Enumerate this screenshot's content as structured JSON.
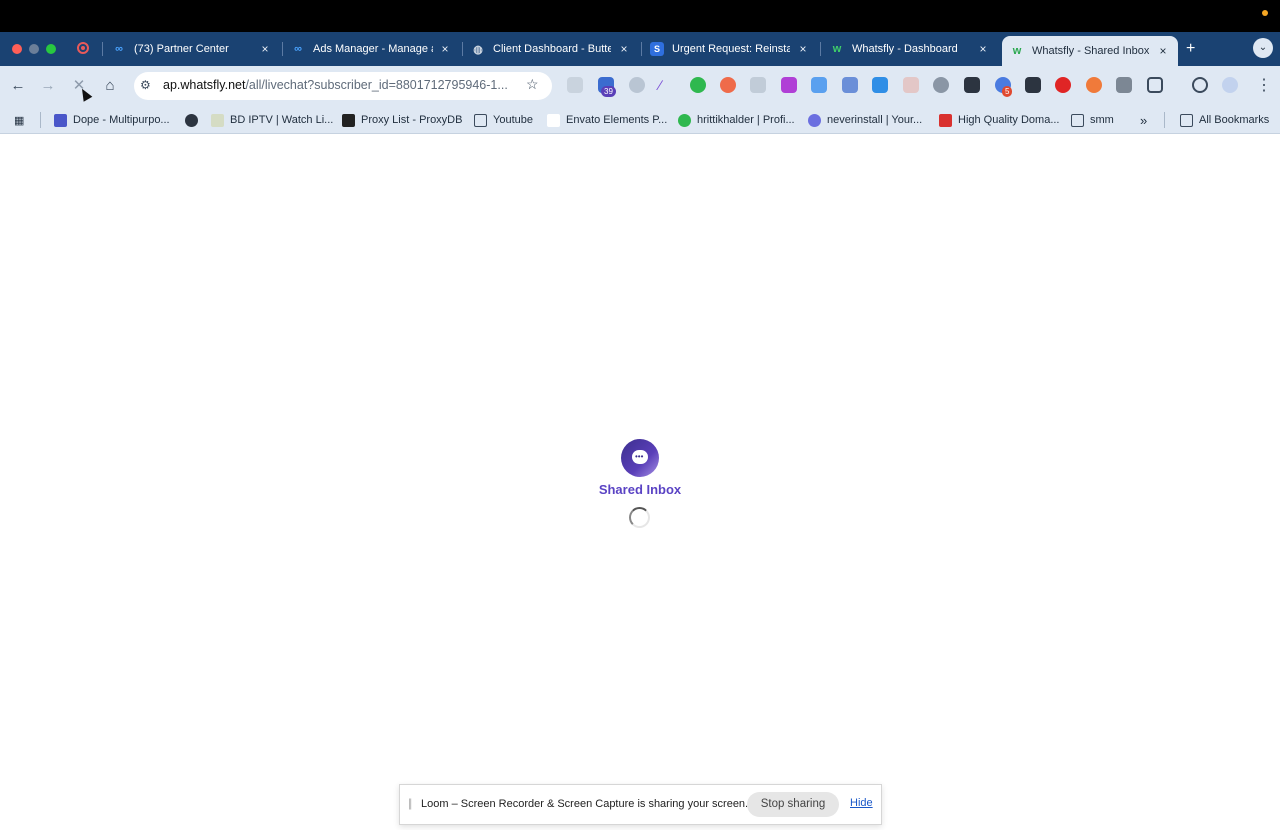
{
  "tabs": [
    {
      "label": "(73) Partner Center",
      "favicon": "meta-icon",
      "close": "×"
    },
    {
      "label": "Ads Manager - Manage a",
      "favicon": "meta-icon",
      "close": "×"
    },
    {
      "label": "Client Dashboard - Butte",
      "favicon": "globe-icon",
      "close": "×"
    },
    {
      "label": "Urgent Request: Reinsta",
      "favicon": "doc-icon",
      "close": "×"
    },
    {
      "label": "Whatsfly - Dashboard",
      "favicon": "whatsfly-icon",
      "close": "×"
    },
    {
      "label": "Whatsfly - Shared Inbox",
      "favicon": "whatsfly-icon",
      "close": "×",
      "active": true
    }
  ],
  "newtab": "+",
  "toolbar": {
    "url_host": "ap.whatsfly.net",
    "url_path": "/all/livechat?subscriber_id=8801712795946-1...",
    "extensions_badges": {
      "calendar": "39",
      "puzzle": "5"
    }
  },
  "bookmarks": [
    {
      "label": "Dope - Multipurpo...",
      "icon": "site-icon"
    },
    {
      "label": "",
      "icon": "globe-icon"
    },
    {
      "label": "BD IPTV | Watch Li...",
      "icon": "site-icon"
    },
    {
      "label": "Proxy List - ProxyDB",
      "icon": "database-icon"
    },
    {
      "label": "Youtube",
      "icon": "folder-icon"
    },
    {
      "label": "Envato Elements P...",
      "icon": "page-icon"
    },
    {
      "label": "hrittikhalder | Profi...",
      "icon": "site-icon"
    },
    {
      "label": "neverinstall | Your...",
      "icon": "site-icon"
    },
    {
      "label": "High Quality Doma...",
      "icon": "site-icon"
    },
    {
      "label": "smm",
      "icon": "folder-icon"
    }
  ],
  "bookmarks_more": "»",
  "all_bookmarks": "All Bookmarks",
  "app": {
    "title": "Shared Inbox"
  },
  "loom": {
    "message": "Loom – Screen Recorder & Screen Capture is sharing your screen.",
    "stop": "Stop sharing",
    "hide": "Hide"
  },
  "colors": {
    "tabstrip": "#1a4272",
    "toolbar": "#dfe8f3",
    "brand": "#5a43c4"
  }
}
